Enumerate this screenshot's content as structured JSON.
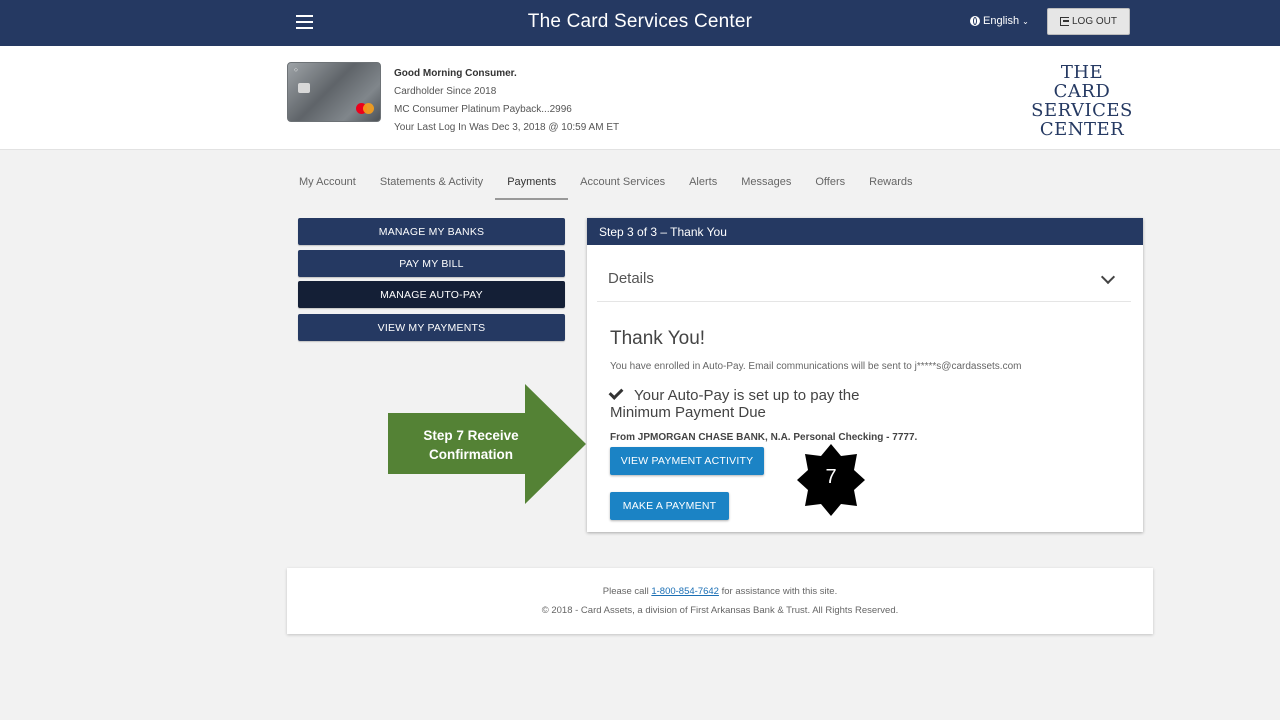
{
  "header": {
    "title": "The Card Services Center",
    "language": "English",
    "logout_label": "LOG OUT",
    "colors": {
      "bar": "#253962"
    }
  },
  "profile": {
    "greeting": "Good Morning Consumer.",
    "since": "Cardholder Since 2018",
    "card_name": "MC Consumer Platinum Payback...2996",
    "last_login": "Your Last Log In Was Dec 3, 2018 @ 10:59 AM ET",
    "logo_lines": [
      "THE",
      "CARD SERVICES",
      "CENTER"
    ]
  },
  "tabs": [
    {
      "label": "My Account"
    },
    {
      "label": "Statements & Activity"
    },
    {
      "label": "Payments",
      "active": true
    },
    {
      "label": "Account Services"
    },
    {
      "label": "Alerts"
    },
    {
      "label": "Messages"
    },
    {
      "label": "Offers"
    },
    {
      "label": "Rewards"
    }
  ],
  "sidebar": {
    "buttons": [
      {
        "label": "MANAGE MY BANKS"
      },
      {
        "label": "PAY MY BILL"
      },
      {
        "label": "MANAGE AUTO-PAY",
        "active": true
      },
      {
        "label": "VIEW MY PAYMENTS"
      }
    ]
  },
  "panel": {
    "header": "Step 3 of 3 – Thank You",
    "details_label": "Details",
    "thank_you": "Thank You!",
    "enroll_message": "You have enrolled in Auto-Pay. Email communications will be sent to j*****s@cardassets.com",
    "autopay_line1": "Your Auto-Pay is set up to pay the",
    "autopay_line2": "Minimum Payment Due",
    "from_account": "From JPMORGAN CHASE BANK, N.A. Personal Checking - 7777.",
    "view_activity_label": "VIEW PAYMENT ACTIVITY",
    "make_payment_label": "MAKE A PAYMENT",
    "button_color": "#1b83c5"
  },
  "annotation": {
    "callout_line1": "Step 7 Receive",
    "callout_line2": "Confirmation",
    "step_number": "7",
    "arrow_color": "#548235"
  },
  "footer": {
    "call_prefix": "Please call ",
    "phone": "1-800-854-7642",
    "call_suffix": " for assistance with this site.",
    "copyright": "© 2018 - Card Assets, a division of First Arkansas Bank & Trust. All Rights Reserved."
  }
}
